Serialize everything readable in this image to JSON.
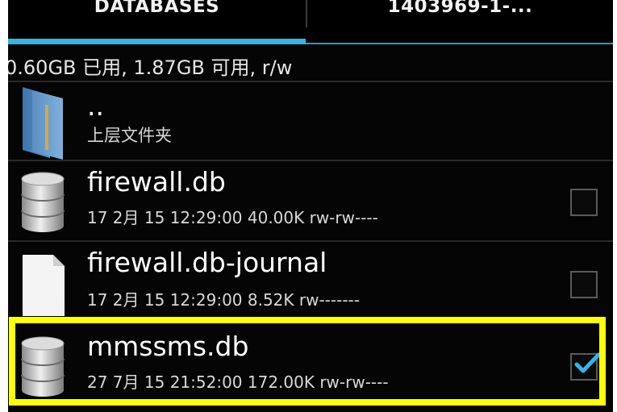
{
  "tabs": [
    {
      "label": "DATABASES",
      "selected": true
    },
    {
      "label": "1403969-1-...",
      "selected": false
    }
  ],
  "storage_info": "0.60GB 已用, 1.87GB 可用, r/w",
  "files": [
    {
      "name": "..",
      "meta": "上层文件夹",
      "icon": "folder-icon",
      "checkable": false
    },
    {
      "name": "firewall.db",
      "meta": "17 2月 15 12:29:00  40.00K  rw-rw----",
      "icon": "database-icon",
      "checked": false
    },
    {
      "name": "firewall.db-journal",
      "meta": "17 2月 15 12:29:00  8.52K  rw-------",
      "icon": "file-icon",
      "checked": false
    },
    {
      "name": "mmssms.db",
      "meta": "27 7月 15 21:52:00  172.00K  rw-rw----",
      "icon": "database-icon",
      "checked": true,
      "highlighted": true
    }
  ],
  "colors": {
    "accent": "#33b5e5",
    "highlight": "#ffff00",
    "background": "#050505"
  }
}
